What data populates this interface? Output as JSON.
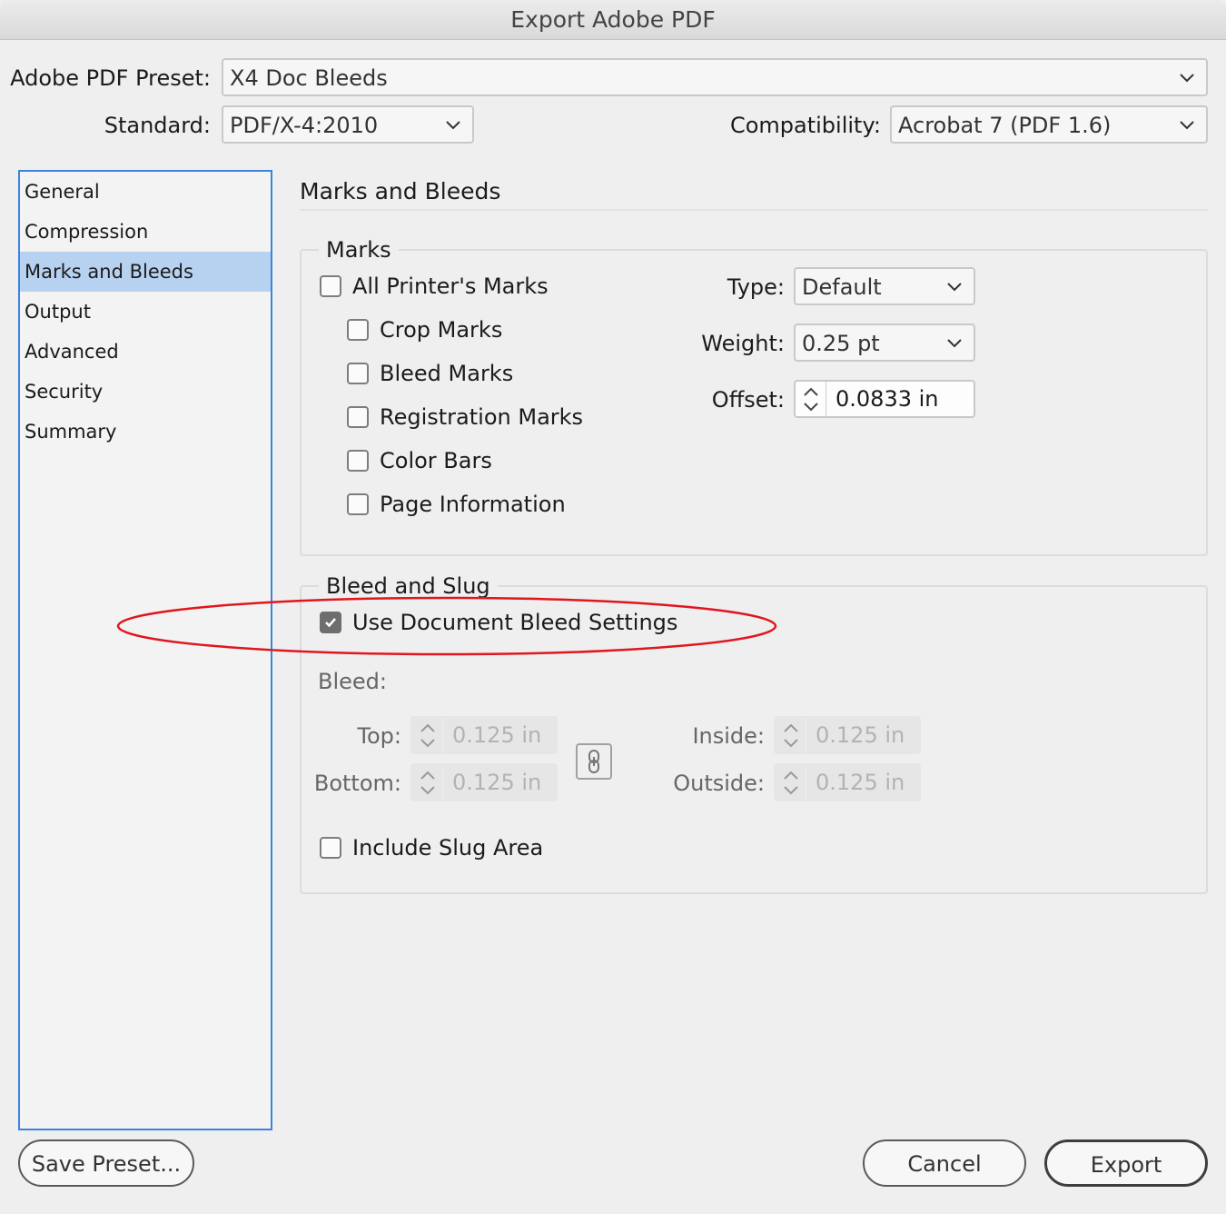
{
  "window": {
    "title": "Export Adobe PDF"
  },
  "header": {
    "preset_label": "Adobe PDF Preset:",
    "preset_value": "X4 Doc Bleeds",
    "standard_label": "Standard:",
    "standard_value": "PDF/X-4:2010",
    "compat_label": "Compatibility:",
    "compat_value": "Acrobat 7 (PDF 1.6)"
  },
  "sidebar": {
    "items": [
      {
        "label": "General"
      },
      {
        "label": "Compression"
      },
      {
        "label": "Marks and Bleeds",
        "selected": true
      },
      {
        "label": "Output"
      },
      {
        "label": "Advanced"
      },
      {
        "label": "Security"
      },
      {
        "label": "Summary"
      }
    ]
  },
  "panel": {
    "title": "Marks and Bleeds",
    "marks": {
      "group_title": "Marks",
      "all_printers_marks": {
        "label": "All Printer's Marks",
        "checked": false
      },
      "options": [
        {
          "label": "Crop Marks",
          "checked": false
        },
        {
          "label": "Bleed Marks",
          "checked": false
        },
        {
          "label": "Registration Marks",
          "checked": false
        },
        {
          "label": "Color Bars",
          "checked": false
        },
        {
          "label": "Page Information",
          "checked": false
        }
      ],
      "type_label": "Type:",
      "type_value": "Default",
      "weight_label": "Weight:",
      "weight_value": "0.25 pt",
      "offset_label": "Offset:",
      "offset_value": "0.0833 in"
    },
    "bleed_slug": {
      "group_title": "Bleed and Slug",
      "use_doc_bleed": {
        "label": "Use Document Bleed Settings",
        "checked": true
      },
      "bleed_label": "Bleed:",
      "top_label": "Top:",
      "top_value": "0.125 in",
      "bottom_label": "Bottom:",
      "bottom_value": "0.125 in",
      "inside_label": "Inside:",
      "inside_value": "0.125 in",
      "outside_label": "Outside:",
      "outside_value": "0.125 in",
      "include_slug": {
        "label": "Include Slug Area",
        "checked": false
      }
    }
  },
  "footer": {
    "save_preset": "Save Preset...",
    "cancel": "Cancel",
    "export": "Export"
  },
  "colors": {
    "sidebar_selection": "#b7d2f0",
    "sidebar_border": "#3b83e0",
    "annotation": "#e0161e"
  }
}
